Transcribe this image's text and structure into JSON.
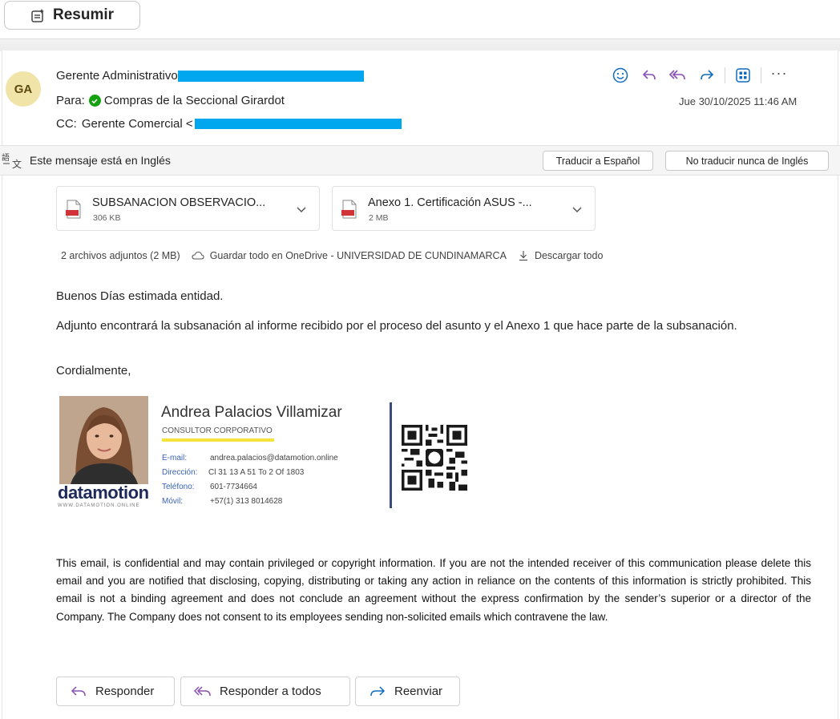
{
  "toolbar": {
    "summarize_label": "Resumir"
  },
  "colors": {
    "accent": "#0f6cbd",
    "reply_purple": "#8a4fb5",
    "avatar_bg": "#f1e4a8",
    "redaction": "#00a6ee",
    "verified": "#13a10e"
  },
  "message": {
    "avatar_initials": "GA",
    "from_name": "Gerente Administrativo",
    "to_label": "Para:",
    "to_name": "Compras de la Seccional Girardot",
    "cc_label": "CC:",
    "cc_name": "Gerente Comercial <",
    "datetime": "Jue 30/10/2025 11:46 AM",
    "action_icons": [
      "emoji-icon",
      "reply-icon",
      "reply-all-icon",
      "forward-icon",
      "apps-icon",
      "more-icon"
    ],
    "more_label": "···"
  },
  "translate": {
    "message": "Este mensaje está en Inglés",
    "translate_button": "Traducir a Español",
    "never_button": "No traducir nunca de Inglés"
  },
  "attachments": {
    "items": [
      {
        "name": "SUBSANACION OBSERVACIO...",
        "size": "306 KB"
      },
      {
        "name": "Anexo 1. Certificación ASUS -...",
        "size": "2 MB"
      }
    ],
    "summary": "2 archivos adjuntos (2 MB)",
    "save_all": "Guardar todo en OneDrive - UNIVERSIDAD DE CUNDINAMARCA",
    "download_all": "Descargar todo"
  },
  "body": {
    "greeting": "Buenos Días estimada entidad.",
    "paragraph": "Adjunto encontrará la subsanación al informe recibido por el proceso del asunto y el Anexo 1 que hace parte de la subsanación.",
    "closing": "Cordialmente,"
  },
  "signature": {
    "name": "Andrea Palacios Villamizar",
    "role": "CONSULTOR CORPORATIVO",
    "rows": [
      {
        "label": "E-mail:",
        "value": "andrea.palacios@datamotion.online"
      },
      {
        "label": "Dirección:",
        "value": "Cl 31 13 A 51 To 2 Of 1803"
      },
      {
        "label": "Teléfono:",
        "value": "601-7734664"
      },
      {
        "label": "Móvil:",
        "value": "+57(1) 313 8014628"
      }
    ],
    "logo_text": "datamotion",
    "logo_url": "WWW.DATAMOTION.ONLINE"
  },
  "disclaimer": "This email, is confidential and may contain privileged or copyright information. If you are not the intended receiver of this communication please delete this email and you are notified that disclosing, copying, distributing or taking any action in reliance on the contents of this information is strictly prohibited. This email is not a binding agreement and does not conclude an agreement without the express confirmation by the sender’s superior or a director of the Company. The Company does not consent to its employees sending non-solicited emails which contravene the law.",
  "footer": {
    "reply": "Responder",
    "reply_all": "Responder a todos",
    "forward": "Reenviar"
  }
}
